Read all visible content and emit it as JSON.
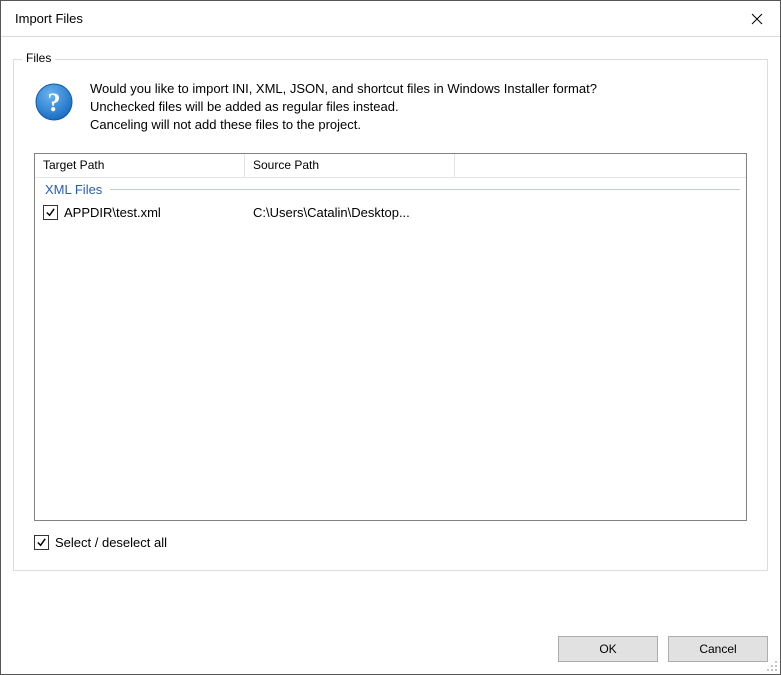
{
  "window": {
    "title": "Import Files"
  },
  "group": {
    "label": "Files",
    "message_line1": "Would you like to import INI, XML, JSON, and shortcut files in Windows Installer format?",
    "message_line2": "Unchecked files will be added as regular files instead.",
    "message_line3": "Canceling will not add these files to the project."
  },
  "table": {
    "columns": {
      "target": "Target Path",
      "source": "Source Path"
    },
    "groups": [
      {
        "name": "XML Files",
        "rows": [
          {
            "checked": true,
            "target": "APPDIR\\test.xml",
            "source": "C:\\Users\\Catalin\\Desktop..."
          }
        ]
      }
    ]
  },
  "selectAll": {
    "checked": true,
    "label": "Select / deselect all"
  },
  "buttons": {
    "ok": "OK",
    "cancel": "Cancel"
  }
}
